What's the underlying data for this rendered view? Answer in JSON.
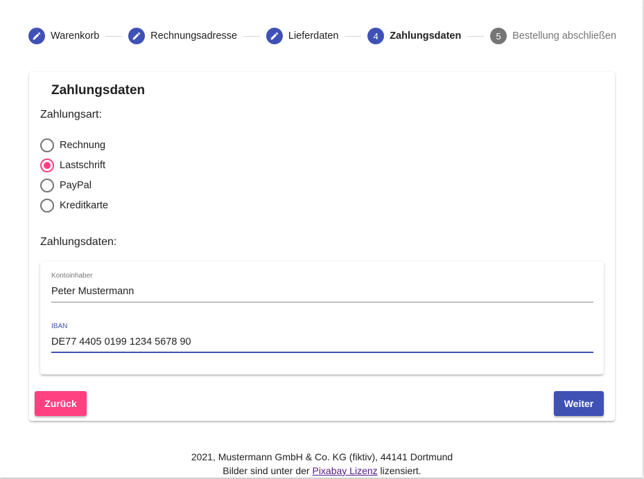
{
  "stepper": {
    "steps": [
      {
        "number": "",
        "label": "Warenkorb",
        "state": "done",
        "icon": "pencil-icon"
      },
      {
        "number": "",
        "label": "Rechnungsadresse",
        "state": "done",
        "icon": "pencil-icon"
      },
      {
        "number": "",
        "label": "Lieferdaten",
        "state": "done",
        "icon": "pencil-icon"
      },
      {
        "number": "4",
        "label": "Zahlungsdaten",
        "state": "active"
      },
      {
        "number": "5",
        "label": "Bestellung abschließen",
        "state": "todo"
      }
    ]
  },
  "card": {
    "title": "Zahlungsdaten",
    "payment_method_label": "Zahlungsart:",
    "payment_methods": [
      {
        "label": "Rechnung",
        "checked": false
      },
      {
        "label": "Lastschrift",
        "checked": true
      },
      {
        "label": "PayPal",
        "checked": false
      },
      {
        "label": "Kreditkarte",
        "checked": false
      }
    ],
    "payment_data_label": "Zahlungsdaten:"
  },
  "fields": {
    "account_holder": {
      "label": "Kontoinhaber",
      "value": "Peter Mustermann"
    },
    "iban": {
      "label": "IBAN",
      "value": "DE77 4405 0199 1234 5678 90"
    }
  },
  "buttons": {
    "back": "Zurück",
    "next": "Weiter"
  },
  "footer": {
    "line1": "2021, Mustermann GmbH & Co. KG (fiktiv), 44141 Dortmund",
    "line2_prefix": "Bilder sind unter der",
    "line2_link": "Pixabay Lizenz",
    "line2_suffix": "lizensiert."
  },
  "colors": {
    "primary": "#3f51b5",
    "accent": "#ff4081",
    "inactive": "#757575"
  }
}
